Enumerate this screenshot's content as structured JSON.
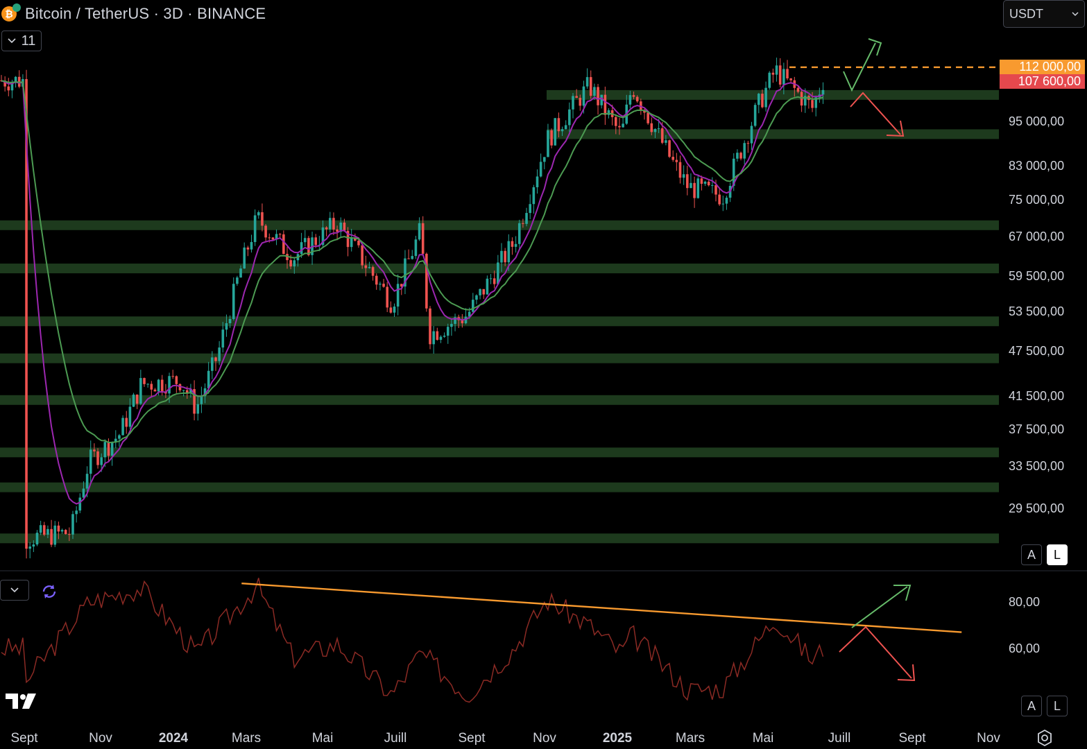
{
  "header": {
    "title": "Bitcoin / TetherUS · 3D · BINANCE",
    "coin_icon": "bitcoin-icon",
    "coin_letter": "₿",
    "collapse_count": "11",
    "currency": "USDT"
  },
  "price_axis": {
    "labels": [
      "95 000,00",
      "83 000,00",
      "75 000,00",
      "67 000,00",
      "59 500,00",
      "53 500,00",
      "47 500,00",
      "41 500,00",
      "37 500,00",
      "33 500,00",
      "29 500,00"
    ],
    "tags": [
      {
        "text": "112 000,00",
        "color": "#f89a2f"
      },
      {
        "text": "107 600,00",
        "color": "#e5484d"
      }
    ]
  },
  "rsi_axis": {
    "labels": [
      "80,00",
      "60,00"
    ]
  },
  "scale_buttons": {
    "auto": "A",
    "log": "L"
  },
  "time_axis": {
    "labels": [
      {
        "text": "Sept",
        "bold": false
      },
      {
        "text": "Nov",
        "bold": false
      },
      {
        "text": "2024",
        "bold": true
      },
      {
        "text": "Mars",
        "bold": false
      },
      {
        "text": "Mai",
        "bold": false
      },
      {
        "text": "Juill",
        "bold": false
      },
      {
        "text": "Sept",
        "bold": false
      },
      {
        "text": "Nov",
        "bold": false
      },
      {
        "text": "2025",
        "bold": true
      },
      {
        "text": "Mars",
        "bold": false
      },
      {
        "text": "Mai",
        "bold": false
      },
      {
        "text": "Juill",
        "bold": false
      },
      {
        "text": "Sept",
        "bold": false
      },
      {
        "text": "Nov",
        "bold": false
      }
    ]
  },
  "colors": {
    "up": "#26a69a",
    "down": "#ef5350",
    "zone": "#1d3a1d",
    "ma_fast": "#9c27b0",
    "ma_slow": "#4c9b52",
    "rsi": "#8b2a24",
    "trendline": "#f89a2f",
    "arrow_up": "#66bb6a",
    "arrow_down": "#ef5350"
  },
  "chart_data": {
    "type": "candlestick",
    "symbol": "Bitcoin / TetherUS",
    "interval": "3D",
    "exchange": "BINANCE",
    "scale": "log",
    "price_levels_marked": [
      112000,
      107600
    ],
    "support_resistance_zones": [
      103000,
      91500,
      69500,
      61000,
      52000,
      46500,
      41000,
      35000,
      31500,
      27000
    ],
    "price_path": [
      [
        "2023-09-01",
        27000
      ],
      [
        "2023-10-10",
        27500
      ],
      [
        "2023-10-25",
        34000
      ],
      [
        "2023-11-20",
        37000
      ],
      [
        "2023-12-08",
        43000
      ],
      [
        "2024-01-10",
        43500
      ],
      [
        "2024-01-23",
        40000
      ],
      [
        "2024-02-10",
        47000
      ],
      [
        "2024-02-28",
        60000
      ],
      [
        "2024-03-14",
        71000
      ],
      [
        "2024-04-13",
        63000
      ],
      [
        "2024-05-20",
        70000
      ],
      [
        "2024-07-05",
        55000
      ],
      [
        "2024-07-29",
        68500
      ],
      [
        "2024-08-05",
        50000
      ],
      [
        "2024-09-06",
        53000
      ],
      [
        "2024-10-15",
        66000
      ],
      [
        "2024-11-12",
        90000
      ],
      [
        "2024-12-17",
        106000
      ],
      [
        "2025-01-13",
        91000
      ],
      [
        "2025-01-22",
        106000
      ],
      [
        "2025-02-25",
        84000
      ],
      [
        "2025-03-10",
        78000
      ],
      [
        "2025-04-08",
        76000
      ],
      [
        "2025-05-08",
        100000
      ],
      [
        "2025-05-22",
        111000
      ],
      [
        "2025-06-22",
        99000
      ],
      [
        "2025-07-01",
        107600
      ]
    ],
    "rsi": {
      "ticks": [
        80,
        60
      ],
      "values": [
        [
          "2023-09-01",
          45
        ],
        [
          "2023-10-25",
          80
        ],
        [
          "2023-12-08",
          86
        ],
        [
          "2024-01-23",
          58
        ],
        [
          "2024-03-14",
          87
        ],
        [
          "2024-04-13",
          56
        ],
        [
          "2024-05-20",
          62
        ],
        [
          "2024-07-05",
          40
        ],
        [
          "2024-07-29",
          58
        ],
        [
          "2024-09-06",
          40
        ],
        [
          "2024-10-15",
          60
        ],
        [
          "2024-11-12",
          81
        ],
        [
          "2024-12-17",
          70
        ],
        [
          "2025-01-13",
          58
        ],
        [
          "2025-01-22",
          66
        ],
        [
          "2025-03-10",
          42
        ],
        [
          "2025-04-08",
          43
        ],
        [
          "2025-05-22",
          73
        ],
        [
          "2025-06-22",
          55
        ],
        [
          "2025-07-01",
          60
        ]
      ],
      "trendline": [
        [
          "2024-03-01",
          88
        ],
        [
          "2025-10-25",
          67
        ]
      ]
    }
  }
}
